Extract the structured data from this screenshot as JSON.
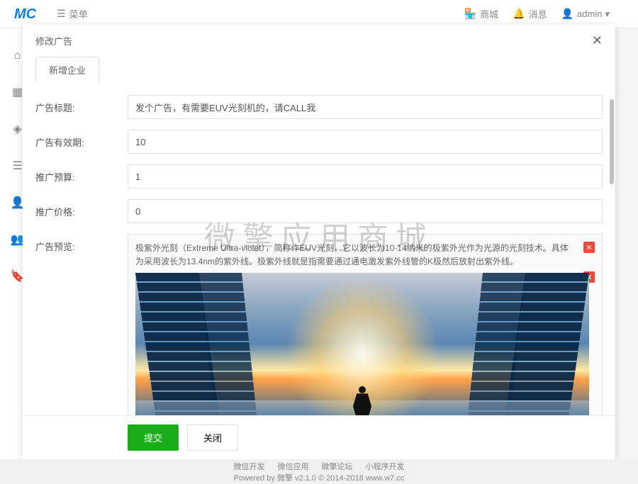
{
  "header": {
    "menu_label": "菜单",
    "mall_label": "商城",
    "message_label": "消息",
    "user_label": "admin"
  },
  "modal": {
    "title": "修改广告",
    "tab_label": "新增企业",
    "fields": {
      "title_label": "广告标题:",
      "title_value": "发个广告，有需要EUV光刻机的，请CALL我",
      "validity_label": "广告有效期:",
      "validity_value": "10",
      "budget_label": "推广预算:",
      "budget_value": "1",
      "price_label": "推广价格:",
      "price_value": "0",
      "preview_label": "广告预览:",
      "preview_text": "极紫外光刻（Extreme Ultra-violet），简称作EUV光刻，它以波长为10-14纳米的极紫外光作为光源的光刻技术。具体为采用波长为13.4nm的紫外线。极紫外线就是指需要通过通电激发紫外线管的K极然后放射出紫外线。"
    },
    "buttons": {
      "submit": "提交",
      "close": "关闭"
    }
  },
  "watermark": "微擎应用商城",
  "footer": {
    "links": [
      "微信开发",
      "微信应用",
      "微擎论坛",
      "小程序开发"
    ],
    "copyright": "Powered by 微擎 v2.1.0 © 2014-2018 www.w7.cc"
  }
}
